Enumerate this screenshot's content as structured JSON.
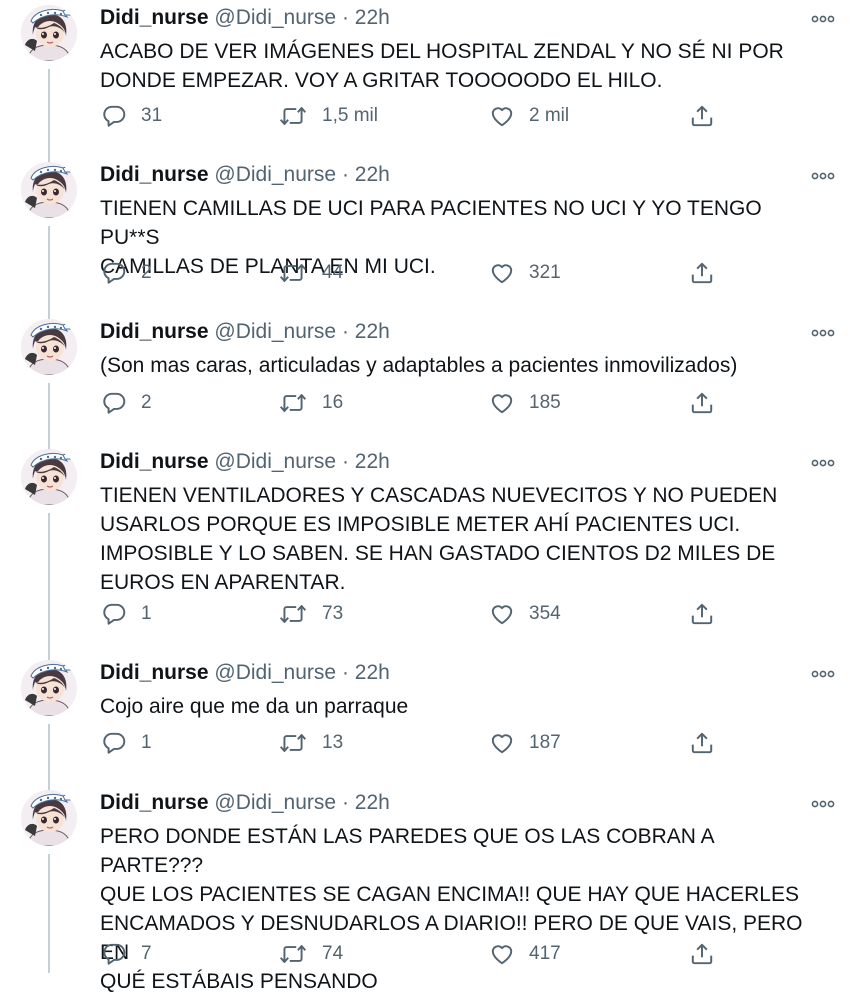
{
  "tweets": [
    {
      "name": "Didi_nurse",
      "handle": "@Didi_nurse",
      "separator": "·",
      "time": "22h",
      "text": "ACABO DE VER IMÁGENES DEL HOSPITAL ZENDAL Y NO SÉ NI POR\nDONDE EMPEZAR. VOY A GRITAR TOOOOODO EL HILO.",
      "replies": "31",
      "retweets": "1,5 mil",
      "likes": "2 mil"
    },
    {
      "name": "Didi_nurse",
      "handle": "@Didi_nurse",
      "separator": "·",
      "time": "22h",
      "text": "TIENEN CAMILLAS DE UCI PARA PACIENTES NO UCI Y YO TENGO PU**S\nCAMILLAS DE PLANTA EN MI UCI.",
      "replies": "2",
      "retweets": "44",
      "likes": "321"
    },
    {
      "name": "Didi_nurse",
      "handle": "@Didi_nurse",
      "separator": "·",
      "time": "22h",
      "text": "(Son mas caras, articuladas y adaptables a pacientes inmovilizados)",
      "replies": "2",
      "retweets": "16",
      "likes": "185"
    },
    {
      "name": "Didi_nurse",
      "handle": "@Didi_nurse",
      "separator": "·",
      "time": "22h",
      "text": "TIENEN VENTILADORES Y CASCADAS NUEVECITOS Y NO PUEDEN\nUSARLOS PORQUE ES IMPOSIBLE METER AHÍ PACIENTES UCI.\nIMPOSIBLE Y LO SABEN. SE HAN GASTADO CIENTOS D2 MILES DE\nEUROS EN APARENTAR.",
      "replies": "1",
      "retweets": "73",
      "likes": "354"
    },
    {
      "name": "Didi_nurse",
      "handle": "@Didi_nurse",
      "separator": "·",
      "time": "22h",
      "text": "Cojo aire que me da un parraque",
      "replies": "1",
      "retweets": "13",
      "likes": "187"
    },
    {
      "name": "Didi_nurse",
      "handle": "@Didi_nurse",
      "separator": "·",
      "time": "22h",
      "text": "PERO DONDE ESTÁN LAS PAREDES QUE OS LAS COBRAN A PARTE???\nQUE LOS PACIENTES SE CAGAN ENCIMA!! QUE HAY QUE HACERLES\nENCAMADOS Y DESNUDARLOS A DIARIO!! PERO DE QUE VAIS, PERO EN\nQUÉ ESTÁBAIS PENSANDO",
      "replies": "7",
      "retweets": "74",
      "likes": "417"
    }
  ],
  "icons": {
    "reply": "reply-icon",
    "retweet": "retweet-icon",
    "like": "heart-icon",
    "share": "share-icon",
    "more": "more-options-icon",
    "avatar": "anime-avatar"
  },
  "colors": {
    "text": "#0f1419",
    "secondary": "#536471",
    "thread_line": "#c4cfd6",
    "background": "#ffffff"
  }
}
